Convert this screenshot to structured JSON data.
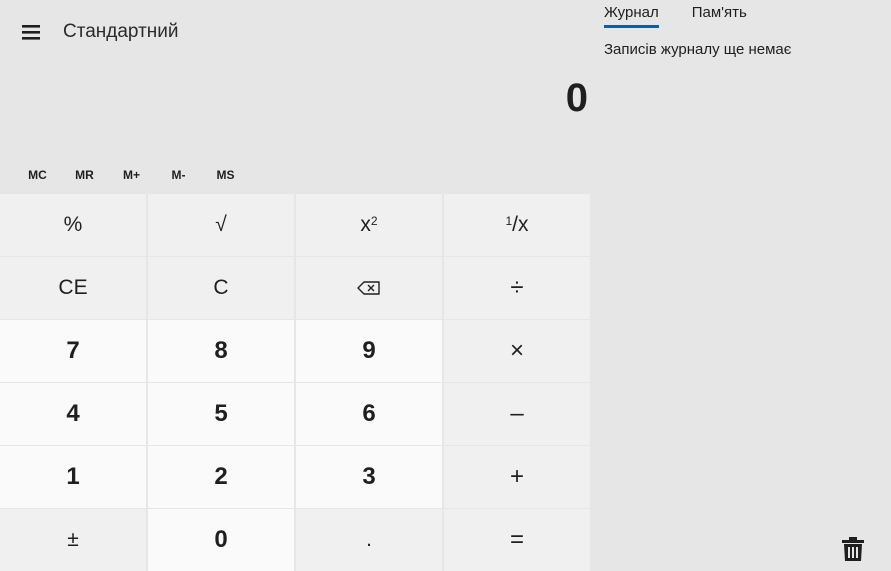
{
  "header": {
    "menu_icon": "hamburger-icon",
    "mode_title": "Стандартний"
  },
  "display": {
    "value": "0"
  },
  "memory": {
    "buttons": [
      "MC",
      "MR",
      "M+",
      "M-",
      "MS"
    ]
  },
  "keypad": {
    "row1": {
      "percent": "%",
      "sqrt": "√",
      "square_base": "x",
      "square_exp": "2",
      "reciprocal_num": "1",
      "reciprocal_rest": "/x"
    },
    "row2": {
      "ce": "CE",
      "c": "C",
      "backspace_icon": "backspace-icon",
      "divide": "÷"
    },
    "row3": {
      "seven": "7",
      "eight": "8",
      "nine": "9",
      "multiply": "×"
    },
    "row4": {
      "four": "4",
      "five": "5",
      "six": "6",
      "minus": "–"
    },
    "row5": {
      "one": "1",
      "two": "2",
      "three": "3",
      "plus": "+"
    },
    "row6": {
      "negate": "±",
      "zero": "0",
      "decimal": ".",
      "equals": "="
    }
  },
  "history_panel": {
    "tabs": [
      {
        "label": "Журнал",
        "active": true
      },
      {
        "label": "Пам'ять",
        "active": false
      }
    ],
    "empty_message": "Записів журналу ще немає",
    "clear_icon": "trash-icon"
  },
  "colors": {
    "background": "#e6e6e6",
    "number_key": "#fafafa",
    "function_key": "#f0f0f0",
    "accent": "#0063b1"
  }
}
